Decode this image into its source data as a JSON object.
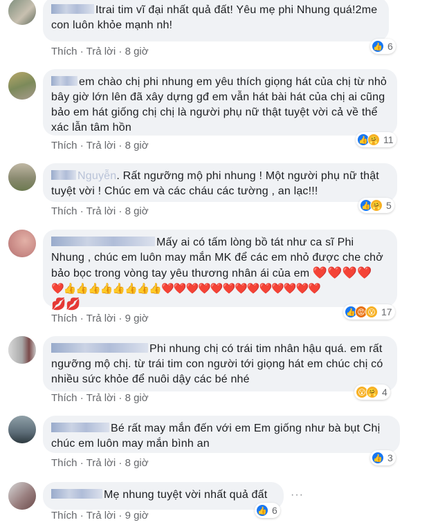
{
  "comments": [
    {
      "text": "Itrai tim vĩ đại nhất quả đất! Yêu mẹ phi Nhung quá!2me con luôn khỏe mạnh nh!",
      "actions": {
        "like": "Thích",
        "reply": "Trả lời",
        "time": "8 giờ"
      },
      "reactions": {
        "icons": [
          "like-icon"
        ],
        "count": "6"
      }
    },
    {
      "text": "em chào chị phi nhung em yêu thích giọng hát của chị từ nhỏ bây giờ lớn lên đã xây dựng gđ em vẫn hát bài hát của chị ai cũng bảo em hát giống chị chị là người phụ nữ thật tuyệt vời cả về thể xác lẫn tâm hồn",
      "actions": {
        "like": "Thích",
        "reply": "Trả lời",
        "time": "8 giờ"
      },
      "reactions": {
        "icons": [
          "like-icon",
          "care-icon"
        ],
        "count": "11"
      }
    },
    {
      "name_fragment": "Nguyễn",
      "text": ". Rất ngưỡng mộ phi nhung ! Một người phụ nữ thật tuyệt vời ! Chúc em và các cháu các tường , an lạc!!!",
      "actions": {
        "like": "Thích",
        "reply": "Trả lời",
        "time": "8 giờ"
      },
      "reactions": {
        "icons": [
          "like-icon",
          "care-icon"
        ],
        "count": "5"
      }
    },
    {
      "text": "Mấy ai có tấm lòng bồ tát như ca sĩ Phi Nhung , chúc em luôn may mắn MK để các em nhỏ được che chở bảo bọc trong vòng tay yêu thương nhân ái của em",
      "emoji_line_1": "❤️❤️❤️❤️",
      "emoji_line_2": "❤️👍👍👍👍👍👍👍👍❤️❤️❤️❤️❤️❤️❤️❤️❤️❤️❤️❤️❤️",
      "emoji_line_3": "💋💋",
      "actions": {
        "like": "Thích",
        "reply": "Trả lời",
        "time": "9 giờ"
      },
      "reactions": {
        "icons": [
          "like-icon",
          "angry-icon",
          "wow-icon"
        ],
        "count": "17"
      }
    },
    {
      "text": "Phi nhung chị có trái tim nhân hậu quá. em rất ngưỡng mộ chị. từ trái tim con người tới giọng hát em chúc chị có nhiều sức khỏe để nuôi dậy các bé nhé",
      "actions": {
        "like": "Thích",
        "reply": "Trả lời",
        "time": "8 giờ"
      },
      "reactions": {
        "icons": [
          "wow-icon",
          "care-icon"
        ],
        "count": "4"
      }
    },
    {
      "text": "Bé rất may mắn đến với em Em giống như bà bụt Chị chúc em luôn may mắn bình an",
      "actions": {
        "like": "Thích",
        "reply": "Trả lời",
        "time": "8 giờ"
      },
      "reactions": {
        "icons": [
          "like-icon"
        ],
        "count": "3"
      }
    },
    {
      "text": "Mẹ nhung tuyệt vời nhất quả đất",
      "actions": {
        "like": "Thích",
        "reply": "Trả lời",
        "time": "9 giờ"
      },
      "reactions": {
        "icons": [
          "like-icon"
        ],
        "count": "6"
      },
      "more_icon": "more-options-icon"
    }
  ],
  "separator": "·"
}
